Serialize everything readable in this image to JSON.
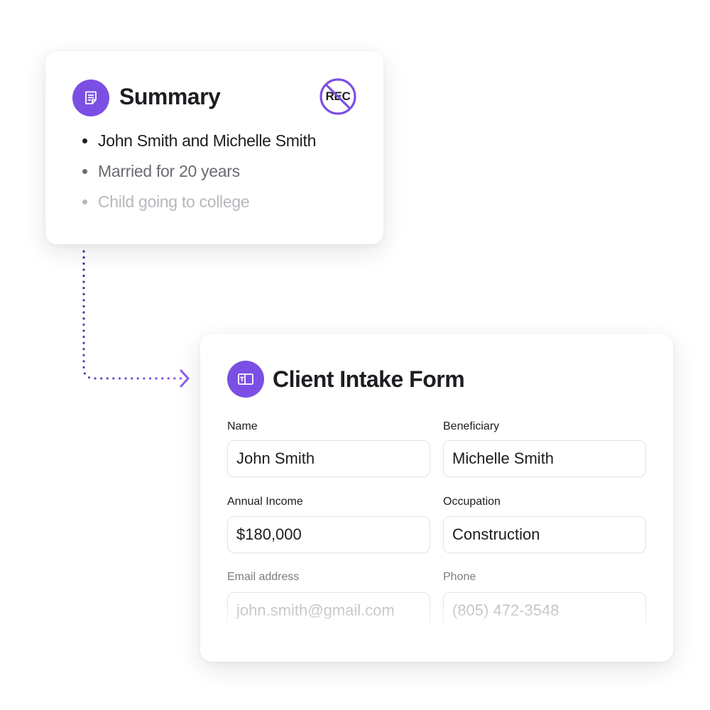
{
  "summary": {
    "title": "Summary",
    "rec_badge": "REC",
    "items": [
      {
        "text": "John Smith and Michelle Smith"
      },
      {
        "text": "Married for 20 years"
      },
      {
        "text": "Child going to college"
      }
    ],
    "icon": "notes-icon"
  },
  "form": {
    "title": "Client Intake Form",
    "icon": "id-card-icon",
    "fields": {
      "name": {
        "label": "Name",
        "value": "John Smith"
      },
      "beneficiary": {
        "label": "Beneficiary",
        "value": "Michelle Smith"
      },
      "annual_income": {
        "label": "Annual Income",
        "value": "$180,000"
      },
      "occupation": {
        "label": "Occupation",
        "value": "Construction"
      },
      "email": {
        "label": "Email address",
        "placeholder": "john.smith@gmail.com"
      },
      "phone": {
        "label": "Phone",
        "placeholder": "(805) 472-3548"
      }
    }
  },
  "colors": {
    "accent": "#7b4fe3",
    "connector": "#5b3fc4",
    "text": "#1d1d22",
    "muted": "#6b6b72",
    "faint": "#b7b7bd"
  }
}
